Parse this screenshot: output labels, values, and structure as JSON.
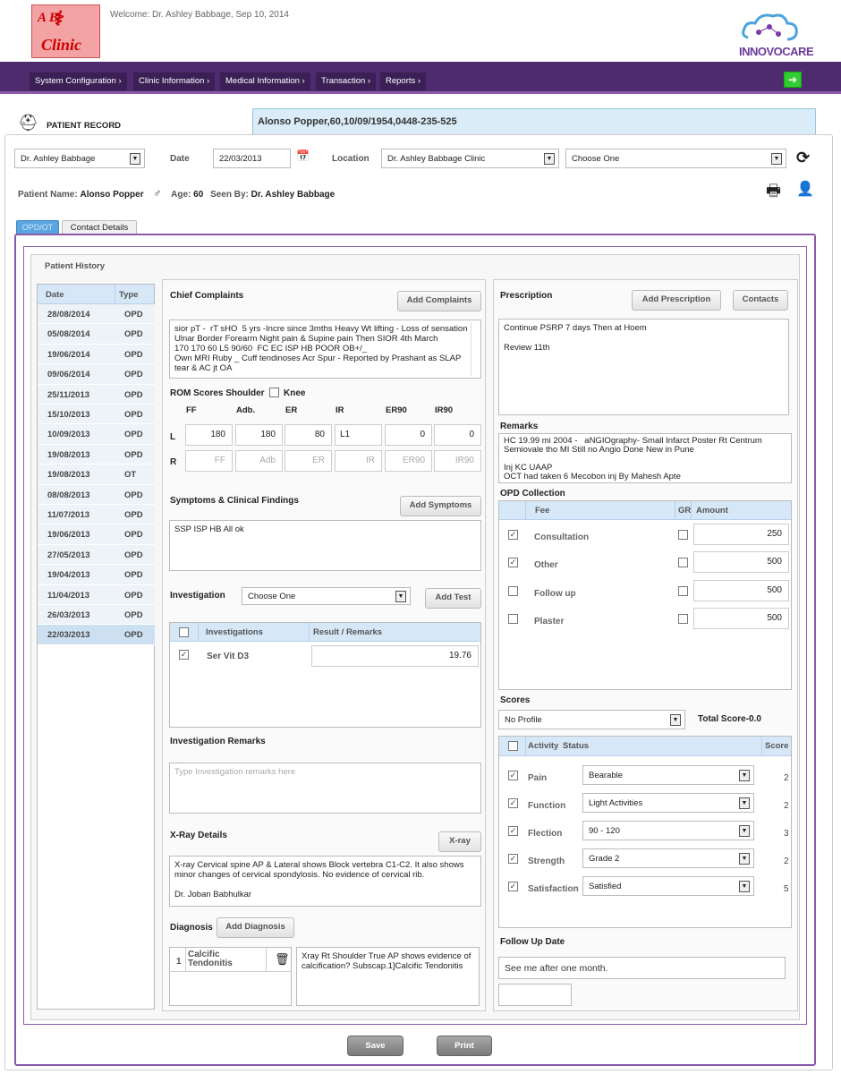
{
  "header": {
    "logo_top": "A   B",
    "logo_bottom": "Clinic",
    "welcome": "Welcome: Dr. Ashley Babbage, Sep 10, 2014",
    "brand": "INNOVOCARE"
  },
  "nav": [
    "System Configuration ›",
    "Clinic Information ›",
    "Medical Information ›",
    "Transaction ›",
    "Reports ›"
  ],
  "record": {
    "title": "PATIENT RECORD",
    "patient_banner": "Alonso Popper,60,10/09/1954,0448-235-525"
  },
  "form": {
    "doctor": "Dr. Ashley Babbage",
    "date_label": "Date",
    "date": "22/03/2013",
    "location_label": "Location",
    "location": "Dr. Ashley Babbage Clinic",
    "choose": "Choose One",
    "patient_name_label": "Patient Name:",
    "patient_name": "Alonso Popper",
    "age_label": "Age:",
    "age": "60",
    "seen_by_label": "Seen By:",
    "seen_by": "Dr. Ashley Babbage"
  },
  "tabs": [
    "OPD/OT",
    "Contact Details"
  ],
  "history": {
    "title": "Patient History",
    "col_date": "Date",
    "col_type": "Type",
    "rows": [
      [
        "28/08/2014",
        "OPD"
      ],
      [
        "05/08/2014",
        "OPD"
      ],
      [
        "19/06/2014",
        "OPD"
      ],
      [
        "09/06/2014",
        "OPD"
      ],
      [
        "25/11/2013",
        "OPD"
      ],
      [
        "15/10/2013",
        "OPD"
      ],
      [
        "10/09/2013",
        "OPD"
      ],
      [
        "19/08/2013",
        "OPD"
      ],
      [
        "19/08/2013",
        "OT"
      ],
      [
        "08/08/2013",
        "OPD"
      ],
      [
        "11/07/2013",
        "OPD"
      ],
      [
        "19/06/2013",
        "OPD"
      ],
      [
        "27/05/2013",
        "OPD"
      ],
      [
        "19/04/2013",
        "OPD"
      ],
      [
        "11/04/2013",
        "OPD"
      ],
      [
        "26/03/2013",
        "OPD"
      ],
      [
        "22/03/2013",
        "OPD"
      ]
    ]
  },
  "chief": {
    "title": "Chief Complaints",
    "button": "Add Complaints",
    "text": "sior pT -  rT sHO  5 yrs -Incre since 3mths Heavy Wt lifting - Loss of sensation Ulnar Border Forearm Night pain & Supine pain Then SIOR 4th March\n170 170 60 L5 90/60  FC EC ISP HB POOR OB+/_\nOwn MRI Ruby _ Cuff tendinoses Acr Spur - Reported by Prashant as SLAP tear & AC jt OA"
  },
  "rom": {
    "title": "ROM Scores Shoulder",
    "knee": "Knee",
    "cols": [
      "FF",
      "Adb.",
      "ER",
      "IR",
      "ER90",
      "IR90"
    ],
    "row_l": "L",
    "row_r": "R",
    "l_values": [
      "180",
      "180",
      "80",
      "L1",
      "0",
      "0"
    ],
    "r_placeholders": [
      "FF",
      "Adb",
      "ER",
      "IR",
      "ER90",
      "IR90"
    ]
  },
  "symptoms": {
    "title": "Symptoms & Clinical Findings",
    "button": "Add Symptoms",
    "text": "SSP ISP HB All ok"
  },
  "investigation": {
    "title": "Investigation",
    "select": "Choose One",
    "button": "Add Test",
    "col1": "Investigations",
    "col2": "Result / Remarks",
    "row_name": "Ser Vit D3",
    "row_value": "19.76"
  },
  "inv_remarks": {
    "title": "Investigation Remarks",
    "placeholder": "Type Investigation remarks here"
  },
  "xray": {
    "title": "X-Ray Details",
    "button": "X-ray",
    "text": "X-ray Cervical spine AP & Lateral shows Block vertebra C1-C2. It also shows minor changes of cervical spondylosis. No evidence of cervical rib.\n\nDr. Joban Babhulkar"
  },
  "diagnosis": {
    "title": "Diagnosis",
    "button": "Add Diagnosis",
    "num": "1",
    "name": "Calcific\nTendonitis",
    "text": "Xray Rt Shoulder True AP shows evidence of calcification? Subscap.1]Calcific Tendonitis"
  },
  "prescription": {
    "title": "Prescription",
    "button": "Add Prescription",
    "contacts": "Contacts",
    "text": "Continue PSRP 7 days Then at Hoem\n\nReview 11th"
  },
  "remarks": {
    "title": "Remarks",
    "text": "HC 19.99 mi 2004 -   aNGIOgraphy- Small Infarct Poster Rt Centrum Semiovale tho MI Still no Angio Done New in Pune\n\nInj KC UAAP\nOCT had taken 6 Mecobon inj By Mahesh Apte"
  },
  "opd": {
    "title": "OPD Collection",
    "col_fee": "Fee",
    "col_gr": "GR",
    "col_amount": "Amount",
    "rows": [
      {
        "fee": "Consultation",
        "checked": "✓",
        "amount": "250"
      },
      {
        "fee": "Other",
        "checked": "✓",
        "amount": "500"
      },
      {
        "fee": "Follow up",
        "checked": "",
        "amount": "500"
      },
      {
        "fee": "Plaster",
        "checked": "",
        "amount": "500"
      }
    ]
  },
  "scores": {
    "title": "Scores",
    "profile": "No Profile",
    "total": "Total Score-0.0",
    "col_activity": "Activity",
    "col_status": "Status",
    "col_score": "Score",
    "rows": [
      {
        "activity": "Pain",
        "status": "Bearable",
        "score": "2"
      },
      {
        "activity": "Function",
        "status": "Light Activities",
        "score": "2"
      },
      {
        "activity": "Flection",
        "status": "90 - 120",
        "score": "3"
      },
      {
        "activity": "Strength",
        "status": "Grade 2",
        "score": "2"
      },
      {
        "activity": "Satisfaction",
        "status": "Satisfied",
        "score": "5"
      }
    ]
  },
  "followup": {
    "title": "Follow Up Date",
    "text": "See me after one month."
  },
  "actions": {
    "save": "Save",
    "print": "Print"
  },
  "colors": {
    "nav": "#4e2a6e",
    "accent": "#8a5aa8",
    "table_header": "#d6e7f7"
  }
}
